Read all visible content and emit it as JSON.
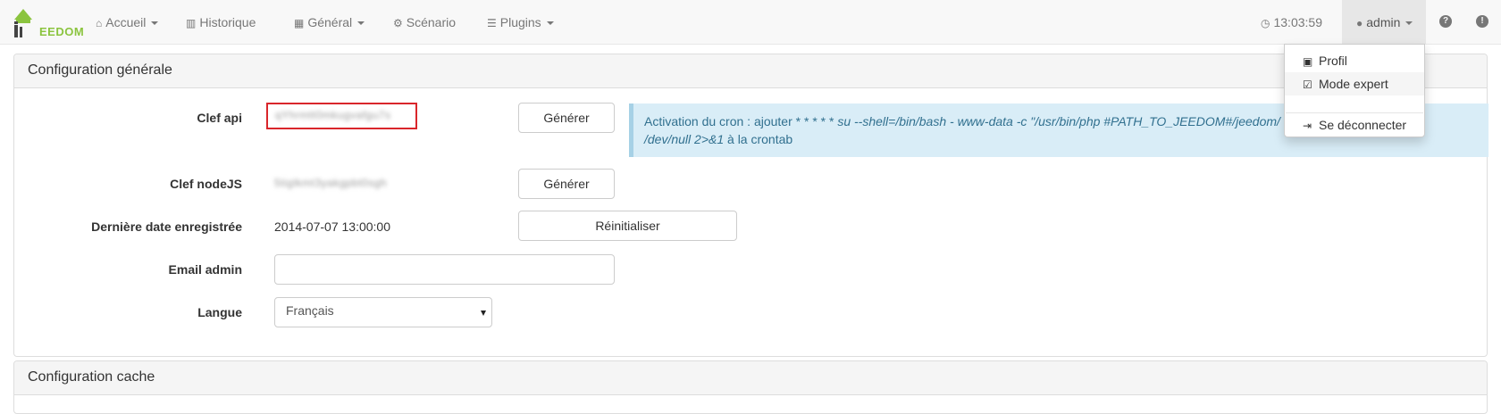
{
  "navbar": {
    "brand": "EEDOM",
    "items": [
      {
        "label": "Accueil",
        "icon": "home-icon",
        "glyph": "⌂",
        "has_caret": true
      },
      {
        "label": "Historique",
        "icon": "bar-chart-icon",
        "glyph": "▥",
        "has_caret": false
      },
      {
        "label": "Général",
        "icon": "grid-icon",
        "glyph": "▦",
        "has_caret": true
      },
      {
        "label": "Scénario",
        "icon": "gears-icon",
        "glyph": "⚙",
        "has_caret": false
      },
      {
        "label": "Plugins",
        "icon": "tasks-icon",
        "glyph": "☰",
        "has_caret": true
      }
    ],
    "clock": "13:03:59",
    "user": "admin",
    "help_glyph": "?",
    "info_glyph": "!"
  },
  "user_menu": {
    "items": [
      {
        "label": "Profil",
        "icon": "briefcase-icon",
        "glyph": "▣"
      },
      {
        "label": "Mode expert",
        "icon": "check-square-icon",
        "glyph": "☑"
      },
      {
        "label": "Se déconnecter",
        "icon": "sign-out-icon",
        "glyph": "⇥"
      }
    ]
  },
  "general": {
    "title": "Configuration générale",
    "api_key_label": "Clef api",
    "api_key_value": "qYhrmtt0mkugvafgu7s",
    "api_generate": "Générer",
    "cron_info": {
      "prefix": "Activation du cron : ajouter * * * * * ",
      "command": "su --shell=/bin/bash - www-data -c \"/usr/bin/php #PATH_TO_JEEDOM#/jeedom/",
      "tail_cmd": "/dev/null 2>&1",
      "suffix": " à la crontab"
    },
    "nodejs_label": "Clef nodeJS",
    "nodejs_value": "5tiglkmt3yakgpbt0sgh",
    "nodejs_generate": "Générer",
    "last_date_label": "Dernière date enregistrée",
    "last_date_value": "2014-07-07 13:00:00",
    "reset_button": "Réinitialiser",
    "email_label": "Email admin",
    "email_value": "",
    "lang_label": "Langue",
    "lang_value": "Français"
  },
  "cache": {
    "title": "Configuration cache"
  },
  "colors": {
    "accent": "#8bc43f",
    "alert_bg": "#d9edf7",
    "alert_text": "#31708f",
    "highlight_border": "#d9262b"
  }
}
